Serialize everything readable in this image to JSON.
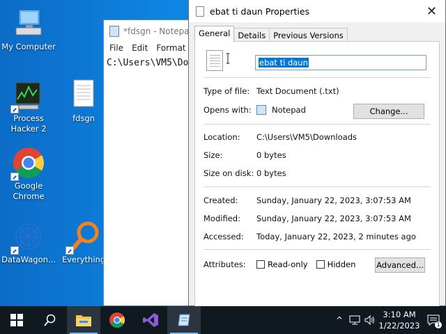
{
  "desktop": {
    "icons": [
      {
        "label": "My Computer"
      },
      {
        "label": "Process Hacker 2"
      },
      {
        "label": "fdsgn"
      },
      {
        "label": "Google Chrome"
      },
      {
        "label": "DataWagon..."
      },
      {
        "label": "Everything"
      }
    ]
  },
  "notepad": {
    "title": "*fdsgn - Notepad",
    "menu": [
      "File",
      "Edit",
      "Format"
    ],
    "content": "C:\\Users\\VM5\\Do"
  },
  "properties": {
    "title": "ebat ti daun Properties",
    "close": "✕",
    "tabs": [
      "General",
      "Details",
      "Previous Versions"
    ],
    "name_value": "ebat ti daun",
    "type_label": "Type of file:",
    "type_value": "Text Document (.txt)",
    "opens_label": "Opens with:",
    "opens_value": "Notepad",
    "change_button": "Change...",
    "location_label": "Location:",
    "location_value": "C:\\Users\\VM5\\Downloads",
    "size_label": "Size:",
    "size_value": "0 bytes",
    "size_disk_label": "Size on disk:",
    "size_disk_value": "0 bytes",
    "created_label": "Created:",
    "created_value": "Sunday, January 22, 2023, 3:07:53 AM",
    "modified_label": "Modified:",
    "modified_value": "Sunday, January 22, 2023, 3:07:53 AM",
    "accessed_label": "Accessed:",
    "accessed_value": "Today, January 22, 2023, 2 minutes ago",
    "attributes_label": "Attributes:",
    "readonly_label": "Read-only",
    "hidden_label": "Hidden",
    "advanced_button": "Advanced..."
  },
  "taskbar": {
    "time": "3:10 AM",
    "date": "1/22/2023",
    "notification_count": "1",
    "tray_chevron": "^"
  },
  "colors": {
    "desktop_bg": "#0a78d4",
    "taskbar_bg": "#101820",
    "selection": "#0078d7"
  }
}
